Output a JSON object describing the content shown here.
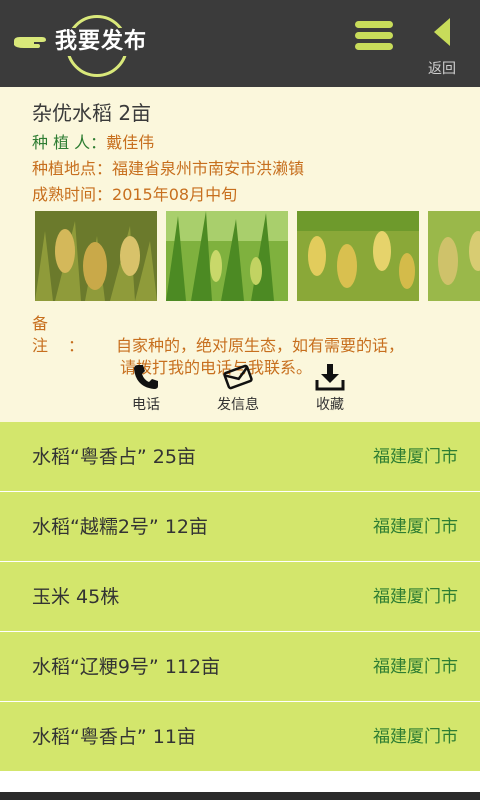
{
  "header": {
    "title": "我要发布",
    "back_label": "返回",
    "colors": {
      "bar": "#3b3b3b",
      "accent": "#c8dc5a"
    }
  },
  "detail": {
    "title": "杂优水稻 2亩",
    "planter_label": "种 植 人：",
    "planter_value": "戴佳伟",
    "location_label": "种植地点：",
    "location_value": "福建省泉州市南安市洪濑镇",
    "harvest_label": "成熟时间：",
    "harvest_value": "2015年08月中旬",
    "note_label": "备注：",
    "note_line1": "自家种的，绝对原生态，如有需要的话，",
    "note_line2": "请拨打我的电话与我联系。",
    "actions": {
      "call": "电话",
      "message": "发信息",
      "favorite": "收藏"
    }
  },
  "list": [
    {
      "name": "水稻“粤香占” 25亩",
      "location": "福建厦门市"
    },
    {
      "name": "水稻“越糯2号” 12亩",
      "location": "福建厦门市"
    },
    {
      "name": "玉米 45株",
      "location": "福建厦门市"
    },
    {
      "name": "水稻“辽粳9号” 112亩",
      "location": "福建厦门市"
    },
    {
      "name": "水稻“粤香占” 11亩",
      "location": "福建厦门市"
    }
  ]
}
